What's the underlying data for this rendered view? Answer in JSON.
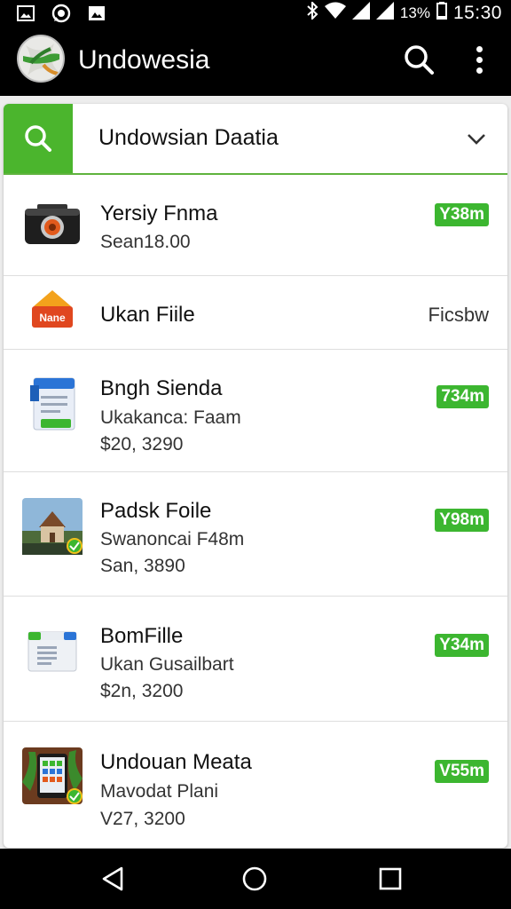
{
  "status_bar": {
    "battery_pct": "13%",
    "time": "15:30",
    "left_icons": [
      "image-icon",
      "whatsapp-icon",
      "photo-icon"
    ],
    "right_icons": [
      "bluetooth-icon",
      "wifi-icon",
      "signal-icon",
      "signal-icon",
      "battery-icon"
    ]
  },
  "app_bar": {
    "title": "Undowesia",
    "actions": [
      "search-icon",
      "more-vert-icon"
    ]
  },
  "selector": {
    "label": "Undowsian Daatia",
    "accent": "#4bb52d"
  },
  "items": [
    {
      "title": "Yersiy Fnma",
      "subtitle": "Sean18.00",
      "price": "",
      "badge": "Y38m",
      "right_text": "",
      "icon": "camera-icon"
    },
    {
      "title": "Ukan Fiile",
      "subtitle": "",
      "price": "",
      "badge": "",
      "right_text": "Ficsbw",
      "icon": "none-folder-icon",
      "icon_label": "Nane"
    },
    {
      "title": "Bngh Sienda",
      "subtitle": "Ukakanca: Faam",
      "price": "$20, 3290",
      "badge": "734m",
      "right_text": "",
      "icon": "document-icon"
    },
    {
      "title": "Padsk Foile",
      "subtitle": "Swanoncai F48m",
      "price": "San, 3890",
      "badge": "Y98m",
      "right_text": "",
      "icon": "house-photo-icon"
    },
    {
      "title": "BomFille",
      "subtitle": "Ukan Gusailbart",
      "price": "$2n, 3200",
      "badge": "Y34m",
      "right_text": "",
      "icon": "doc-window-icon"
    },
    {
      "title": "Undouan Meata",
      "subtitle": "Mavodat Plani",
      "price": "V27, 3200",
      "badge": "V55m",
      "right_text": "",
      "icon": "tablet-photo-icon"
    }
  ],
  "nav_bar": [
    "back-icon",
    "home-icon",
    "recents-icon"
  ]
}
